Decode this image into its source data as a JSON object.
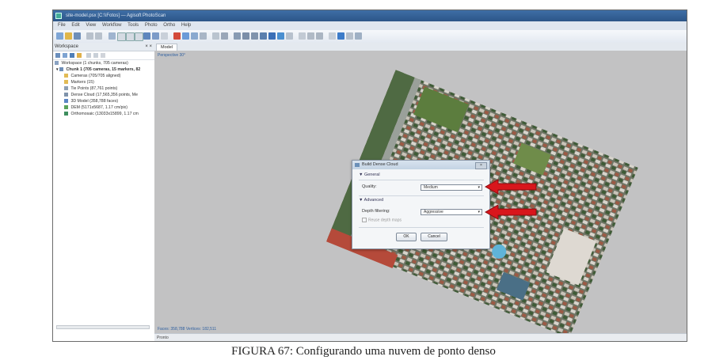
{
  "window": {
    "title": "site-model.psx [C:\\\\Fotos] — Agisoft PhotoScan"
  },
  "menubar": {
    "items": [
      "File",
      "Edit",
      "View",
      "Workflow",
      "Tools",
      "Photo",
      "Ortho",
      "Help"
    ]
  },
  "workspace": {
    "panel_title": "Workspace",
    "close_glyph": "× ×",
    "root_label": "Workspace (1 chunks, 705 cameras)",
    "chunk_label": "Chunk 1 (705 cameras, 15 markers, 82",
    "items": [
      "Cameras (705/705 aligned)",
      "Markers (15)",
      "Tie Points (87,761 points)",
      "Dense Cloud (17,565,356 points, Me",
      "3D Model (358,788 faces)",
      "DEM (5171x5687, 1.17 cm/pix)",
      "Orthomosaic (13033x15899, 1.17 cm"
    ]
  },
  "viewport": {
    "tab_label": "Model",
    "projection_label": "Perspective 30°",
    "status_text": "Faces: 358,788  Vertices: 182,511"
  },
  "statusbar": {
    "text": "Pronto"
  },
  "dialog": {
    "title": "Build Dense Cloud",
    "close_label": "×",
    "general_header": "▼ General",
    "quality_label": "Quality:",
    "quality_value": "Medium",
    "advanced_header": "▼ Advanced",
    "depth_filtering_label": "Depth filtering:",
    "depth_filtering_value": "Aggressive",
    "reuse_depth_label": "Reuse depth maps",
    "ok_label": "OK",
    "cancel_label": "Cancel"
  },
  "caption": "FIGURA 67: Configurando uma nuvem de ponto denso",
  "colors": {
    "arrow": "#d8161c",
    "titlebar": "#2c5588",
    "viewport_bg": "#c2c2c3"
  }
}
